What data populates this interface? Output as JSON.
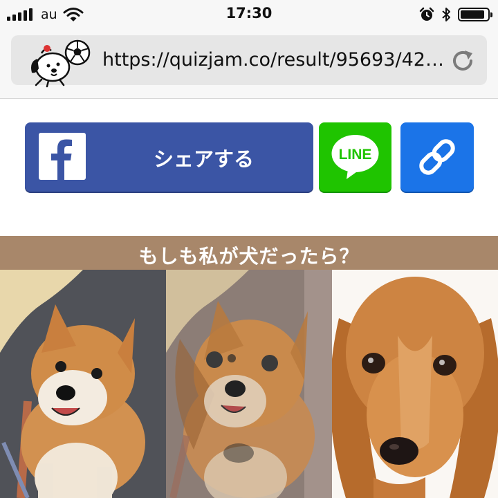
{
  "status_bar": {
    "carrier": "au",
    "time": "17:30",
    "battery_level": 0.9
  },
  "browser": {
    "url": "https://quizjam.co/result/95693/4215…",
    "site_icon": "dog-with-soccer-ball-icon",
    "reload_icon": "reload-icon"
  },
  "share": {
    "facebook_label": "シェアする",
    "line_label": "LINE",
    "link_icon": "link-icon"
  },
  "result": {
    "title": "もしも私が犬だったら？",
    "photos": [
      "user-dog-photo",
      "blended-dog-photo",
      "matched-dog-photo"
    ]
  },
  "colors": {
    "facebook": "#3b55a5",
    "line": "#1fc400",
    "link": "#1b74e8",
    "banner": "#a8876a"
  }
}
